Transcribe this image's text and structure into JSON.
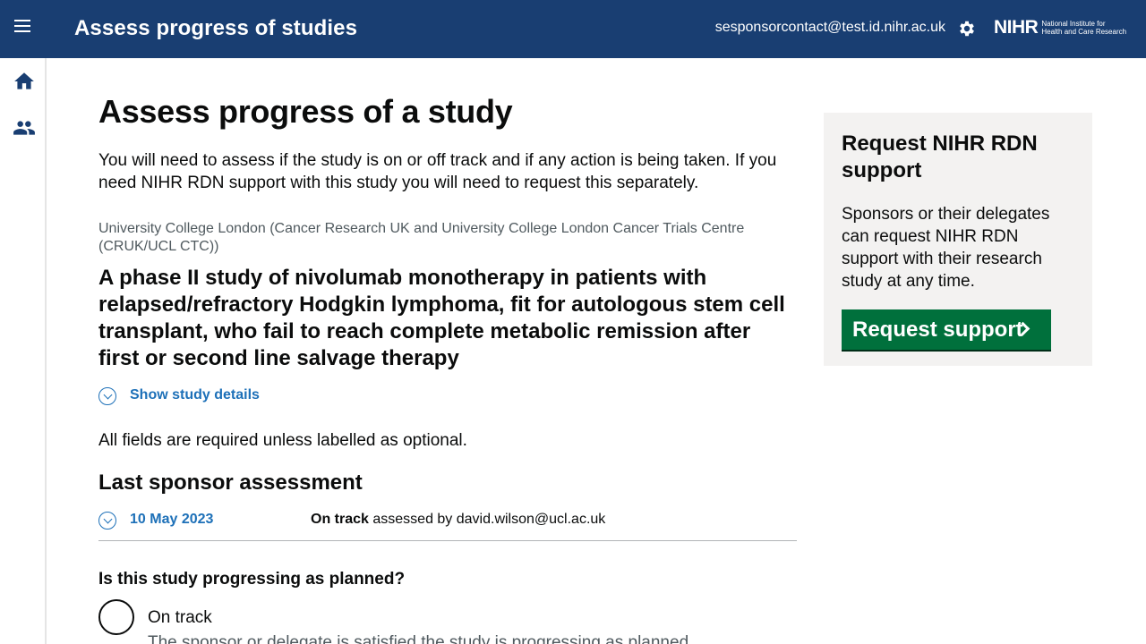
{
  "header": {
    "app_title": "Assess progress of studies",
    "user_email": "sesponsorcontact@test.id.nihr.ac.uk",
    "logo_mark": "NIHR",
    "logo_line1": "National Institute for",
    "logo_line2": "Health and Care Research",
    "icons": [
      "menu-icon",
      "gear-icon"
    ],
    "bar_color": "#193e72"
  },
  "sidebar": {
    "items": [
      {
        "icon": "home-icon"
      },
      {
        "icon": "people-icon"
      }
    ]
  },
  "main": {
    "title": "Assess progress of a study",
    "intro": "You will need to assess if the study is on or off track and if any action is being taken. If you need NIHR RDN support with this study you will need to request this separately.",
    "organisation": "University College London (Cancer Research UK and University College London Cancer Trials Centre (CRUK/UCL CTC))",
    "study_title": "A phase II study of nivolumab monotherapy in patients with relapsed/refractory Hodgkin lymphoma, fit for autologous stem cell transplant, who fail to reach complete metabolic remission after first or second line salvage therapy",
    "show_details_label": "Show study details",
    "required_note": "All fields are required unless labelled as optional.",
    "last_assessment_heading": "Last sponsor assessment",
    "last_assessment": {
      "date": "10 May 2023",
      "status": "On track",
      "assessed_by_text": " assessed by david.wilson@ucl.ac.uk"
    },
    "question": "Is this study progressing as planned?",
    "options": [
      {
        "label": "On track",
        "hint": "The sponsor or delegate is satisfied the study is progressing as planned."
      }
    ]
  },
  "aside": {
    "heading": "Request NIHR RDN support",
    "body": "Sponsors or their delegates can request NIHR RDN support with their research study at any time.",
    "button_label": "Request support",
    "button_color": "#00703c"
  }
}
